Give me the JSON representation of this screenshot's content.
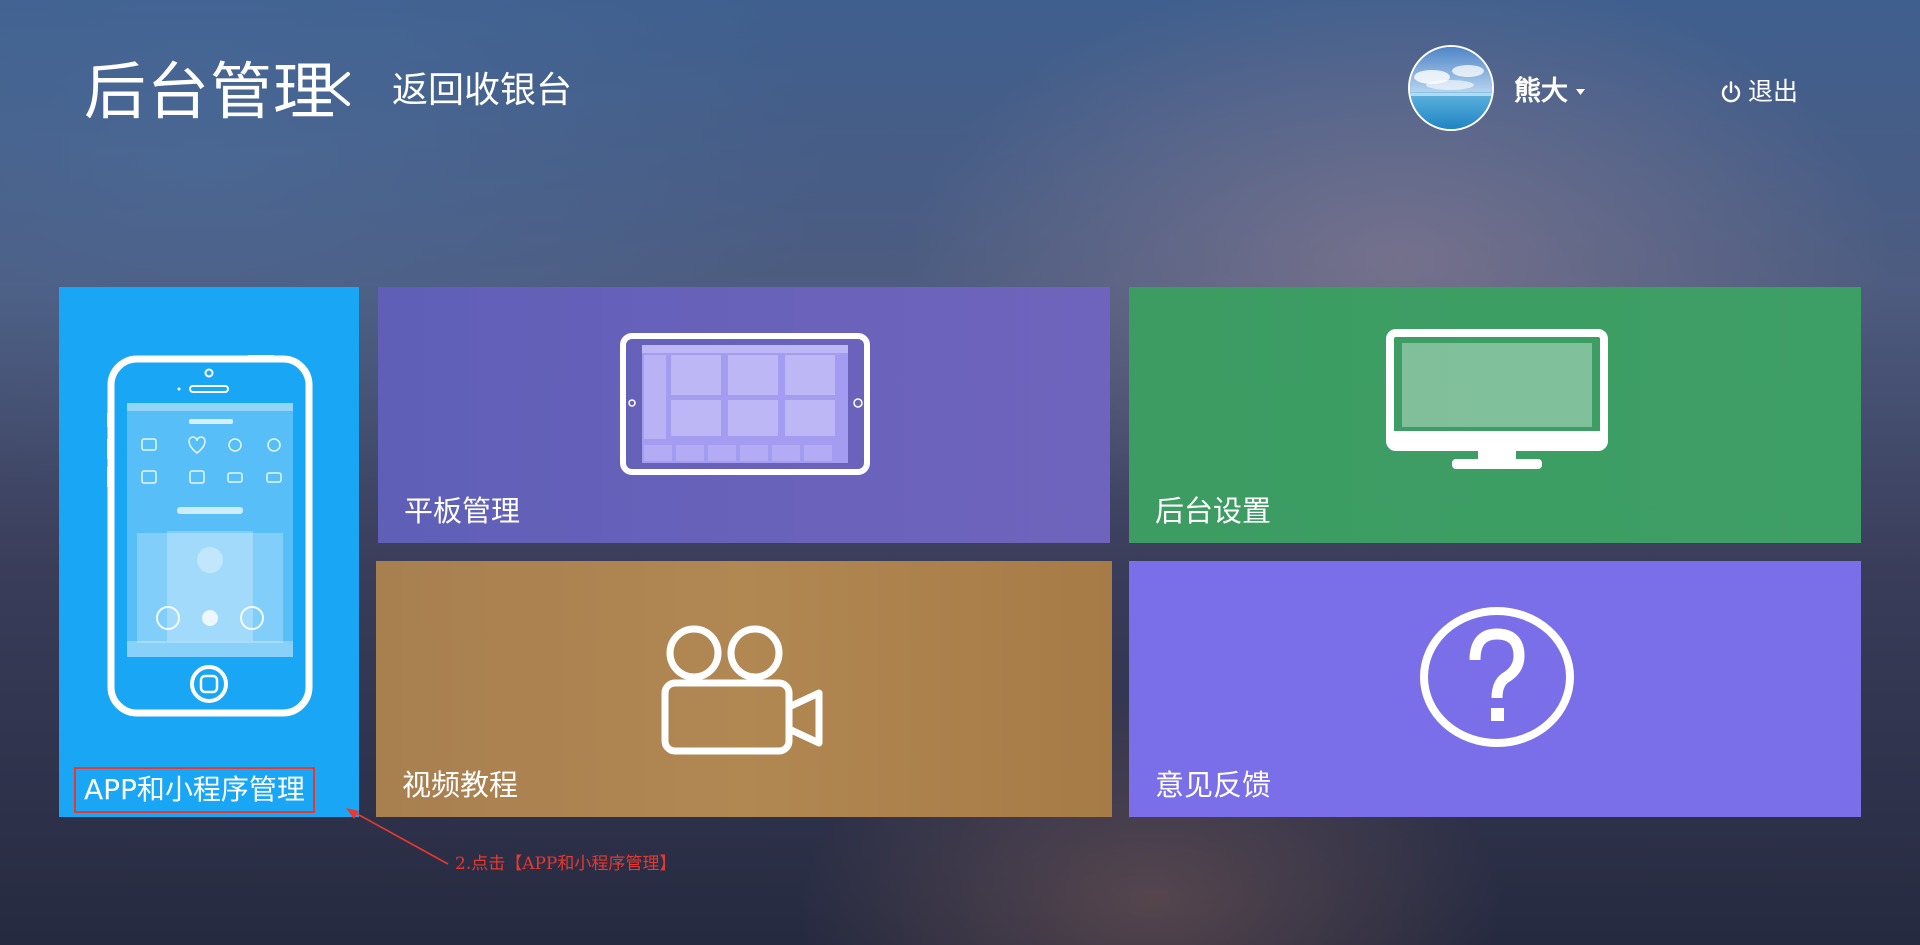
{
  "header": {
    "title": "后台管理",
    "back_link": "返回收银台",
    "user": {
      "name": "熊大",
      "avatar_icon": "sea-landscape-avatar"
    },
    "logout_label": "退出"
  },
  "tiles": [
    {
      "id": "app",
      "label": "APP和小程序管理",
      "color": "#18a6f5",
      "icon": "smartphone-icon"
    },
    {
      "id": "tablet",
      "label": "平板管理",
      "color": "#6760b9",
      "icon": "tablet-icon"
    },
    {
      "id": "settings",
      "label": "后台设置",
      "color": "#3d9e64",
      "icon": "monitor-icon"
    },
    {
      "id": "video",
      "label": "视频教程",
      "color": "#ad8450",
      "icon": "video-camera-icon"
    },
    {
      "id": "feedback",
      "label": "意见反馈",
      "color": "#7a6fe9",
      "icon": "question-circle-icon"
    }
  ],
  "annotation": {
    "text": "2.点击【APP和小程序管理】",
    "color": "#e8382f"
  }
}
